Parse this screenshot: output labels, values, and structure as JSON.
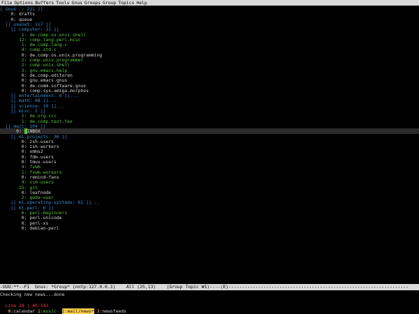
{
  "menu": [
    "File",
    "Options",
    "Buffers",
    "Tools",
    "Gnus",
    "Groups",
    "Group",
    "Topics",
    "Help"
  ],
  "lines": [
    {
      "indent": 0,
      "kind": "topic",
      "text": "[ Gnus -- 221 ]]"
    },
    {
      "indent": 2,
      "kind": "group",
      "count": "0",
      "name": "drafts",
      "color": "grey"
    },
    {
      "indent": 2,
      "kind": "group",
      "count": "0",
      "name": "queue",
      "color": "grey"
    },
    {
      "indent": 2,
      "kind": "topic",
      "text": "[[ usenet: 117 ]]"
    },
    {
      "indent": 4,
      "kind": "topic",
      "text": "[[ computer: 31 ]]"
    },
    {
      "indent": 6,
      "kind": "group",
      "count": "1",
      "name": "de.comp.os.unix.shell",
      "color": "green"
    },
    {
      "indent": 6,
      "kind": "group",
      "count": "12",
      "name": "comp.lang.perl.misc",
      "color": "green"
    },
    {
      "indent": 6,
      "kind": "group",
      "count": "1",
      "name": "de.comp.lang.c",
      "color": "green"
    },
    {
      "indent": 6,
      "kind": "group",
      "count": "4",
      "name": "comp.std.c",
      "color": "green"
    },
    {
      "indent": 6,
      "kind": "group",
      "count": "0",
      "name": "de.comp.os.unix.programming",
      "color": "grey"
    },
    {
      "indent": 6,
      "kind": "group",
      "count": "2",
      "name": "comp.unix.programmer",
      "color": "green"
    },
    {
      "indent": 6,
      "kind": "group",
      "count": "2",
      "name": "comp.unix.shell",
      "color": "green"
    },
    {
      "indent": 6,
      "kind": "group",
      "count": "3",
      "name": "gnu.emacs.help",
      "color": "green"
    },
    {
      "indent": 6,
      "kind": "group",
      "count": "0",
      "name": "de.comp.editoren",
      "color": "grey"
    },
    {
      "indent": 6,
      "kind": "group",
      "count": "0",
      "name": "gnu.emacs.gnus",
      "color": "grey"
    },
    {
      "indent": 6,
      "kind": "group",
      "count": "0",
      "name": "de.comm.software.gnus",
      "color": "grey"
    },
    {
      "indent": 6,
      "kind": "group",
      "count": "0",
      "name": "comp.sys.amiga.morphos",
      "color": "grey"
    },
    {
      "indent": 4,
      "kind": "topic",
      "text": "[[ entertainment: 6 ]]..."
    },
    {
      "indent": 4,
      "kind": "topic",
      "text": "[[ math: 68 ]]..."
    },
    {
      "indent": 4,
      "kind": "topic",
      "text": "[[ science: 10 ]]..."
    },
    {
      "indent": 4,
      "kind": "topic",
      "text": "[[ misc: 2 ]]"
    },
    {
      "indent": 6,
      "kind": "group",
      "count": "1",
      "name": "de.org.ccc",
      "color": "green"
    },
    {
      "indent": 6,
      "kind": "group",
      "count": "1",
      "name": "de.comp.text.tex",
      "color": "green"
    },
    {
      "indent": 2,
      "kind": "topic",
      "text": "[[ mail: 104 ]]"
    },
    {
      "indent": 4,
      "kind": "group",
      "count": "0",
      "name": "INBOX",
      "color": "grey",
      "cursor": true,
      "highlight": true
    },
    {
      "indent": 4,
      "kind": "topic",
      "text": "[[ ml.projects: 36 ]]"
    },
    {
      "indent": 6,
      "kind": "group",
      "count": "0",
      "name": "zsh-users",
      "color": "grey"
    },
    {
      "indent": 6,
      "kind": "group",
      "count": "0",
      "name": "zsh-workers",
      "color": "grey"
    },
    {
      "indent": 6,
      "kind": "group",
      "count": "0",
      "name": "xmms2",
      "color": "grey"
    },
    {
      "indent": 6,
      "kind": "group",
      "count": "0",
      "name": "fdm-users",
      "color": "grey"
    },
    {
      "indent": 6,
      "kind": "group",
      "count": "0",
      "name": "tmux-users",
      "color": "grey"
    },
    {
      "indent": 6,
      "kind": "group",
      "count": "4",
      "name": "fvwm",
      "color": "green"
    },
    {
      "indent": 6,
      "kind": "group",
      "count": "1",
      "name": "fvwm-workers",
      "color": "green"
    },
    {
      "indent": 6,
      "kind": "group",
      "count": "0",
      "name": "remind-fans",
      "color": "grey"
    },
    {
      "indent": 6,
      "kind": "group",
      "count": "4",
      "name": "vim-users",
      "color": "green"
    },
    {
      "indent": 6,
      "kind": "group",
      "count": "25",
      "name": "git",
      "color": "green"
    },
    {
      "indent": 6,
      "kind": "group",
      "count": "0",
      "name": "leafnode",
      "color": "grey"
    },
    {
      "indent": 6,
      "kind": "group",
      "count": "2",
      "name": "geda-user",
      "color": "green"
    },
    {
      "indent": 4,
      "kind": "topic",
      "text": "[[ ml.operating-systems: 62 ]]..."
    },
    {
      "indent": 4,
      "kind": "topic",
      "text": "[[ ml.perl: 6 ]]"
    },
    {
      "indent": 6,
      "kind": "group",
      "count": "6",
      "name": "perl-beginners",
      "color": "green"
    },
    {
      "indent": 6,
      "kind": "group",
      "count": "0",
      "name": "perl-unicode",
      "color": "grey"
    },
    {
      "indent": 6,
      "kind": "group",
      "count": "0",
      "name": "perl-xs",
      "color": "grey"
    },
    {
      "indent": 6,
      "kind": "group",
      "count": "0",
      "name": "debian-perl",
      "color": "grey"
    }
  ],
  "modeline": "-UUU:**--F1  Gnus: *Group* (nntp:127.0.0.1)    All (25,13)    (Group Topic WS)----(E)-------------------------------------------------------------------",
  "echo": "Checking new news...done",
  "tmux": {
    "position": "Line 28 | 40:193",
    "windows": [
      {
        "num": "0",
        "name": "calendar",
        "active": false
      },
      {
        "num": "1",
        "name": "music-",
        "active": false
      },
      {
        "num": "2",
        "name": "mail/news*",
        "active": true
      },
      {
        "num": "3",
        "name": "newsfeeds",
        "active": false
      }
    ]
  },
  "colors": {
    "green": "#58c23e",
    "topic": "#3a8fd0",
    "grey": "#d3d3d3",
    "tmux_active": "#ffd24a",
    "tmux_pos": "#ff3b3b"
  }
}
